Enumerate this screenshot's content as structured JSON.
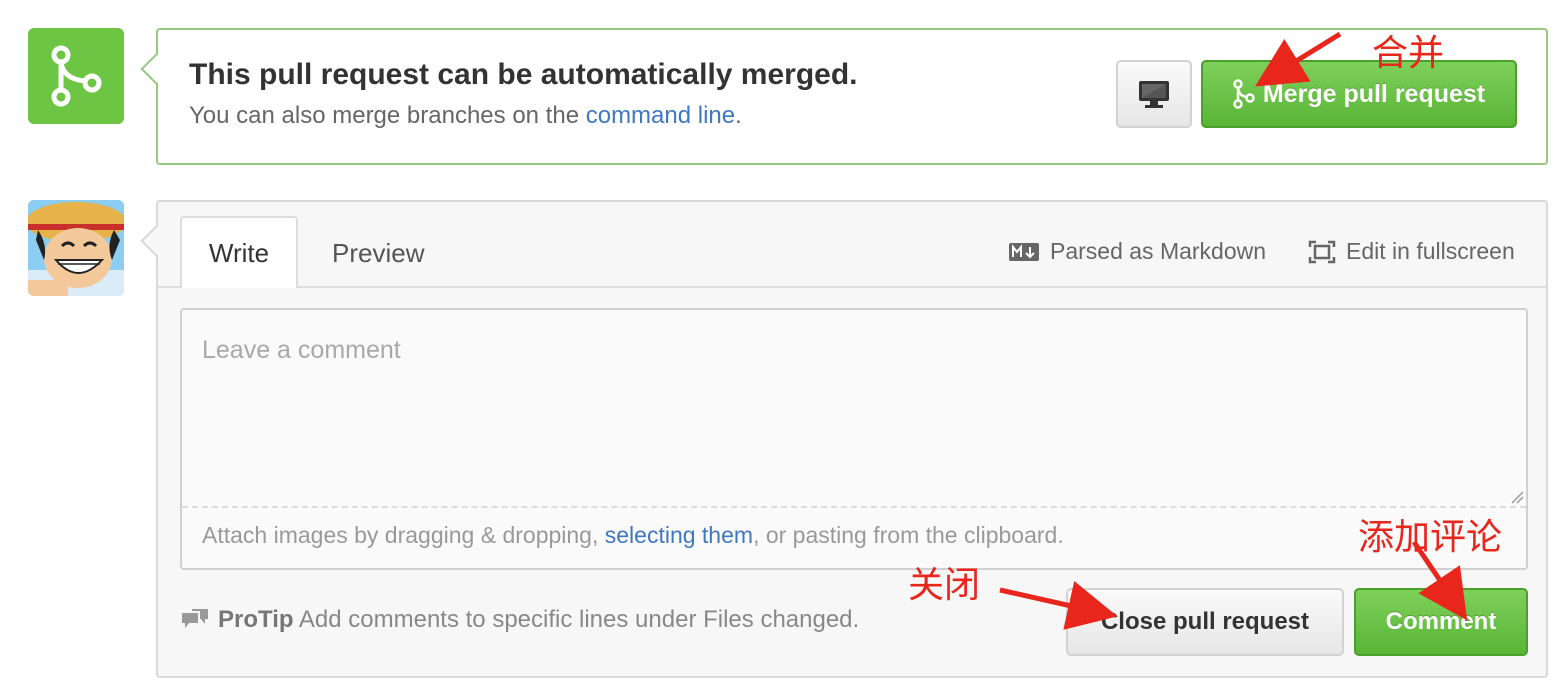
{
  "merge": {
    "title": "This pull request can be automatically merged.",
    "subtitle_prefix": "You can also merge branches on the ",
    "subtitle_link": "command line",
    "subtitle_suffix": ".",
    "merge_button_label": "Merge pull request"
  },
  "comment_form": {
    "tabs": [
      {
        "label": "Write",
        "active": true
      },
      {
        "label": "Preview",
        "active": false
      }
    ],
    "markdown_note": "Parsed as Markdown",
    "fullscreen_label": "Edit in fullscreen",
    "textarea_placeholder": "Leave a comment",
    "attach_prefix": "Attach images by dragging & dropping, ",
    "attach_link": "selecting them",
    "attach_suffix": ", or pasting from the clipboard.",
    "protip_label": "ProTip",
    "protip_text": " Add comments to specific lines under Files changed.",
    "close_button_label": "Close pull request",
    "comment_button_label": "Comment"
  },
  "annotations": {
    "merge": "合并",
    "close": "关闭",
    "comment": "添加评论"
  },
  "colors": {
    "green": "#6cc644",
    "link": "#4078c0",
    "annotation_red": "#e8261c"
  },
  "icons": [
    "git-merge-icon",
    "desktop-icon",
    "markdown-icon",
    "fullscreen-icon",
    "comment-discussion-icon",
    "avatar"
  ]
}
